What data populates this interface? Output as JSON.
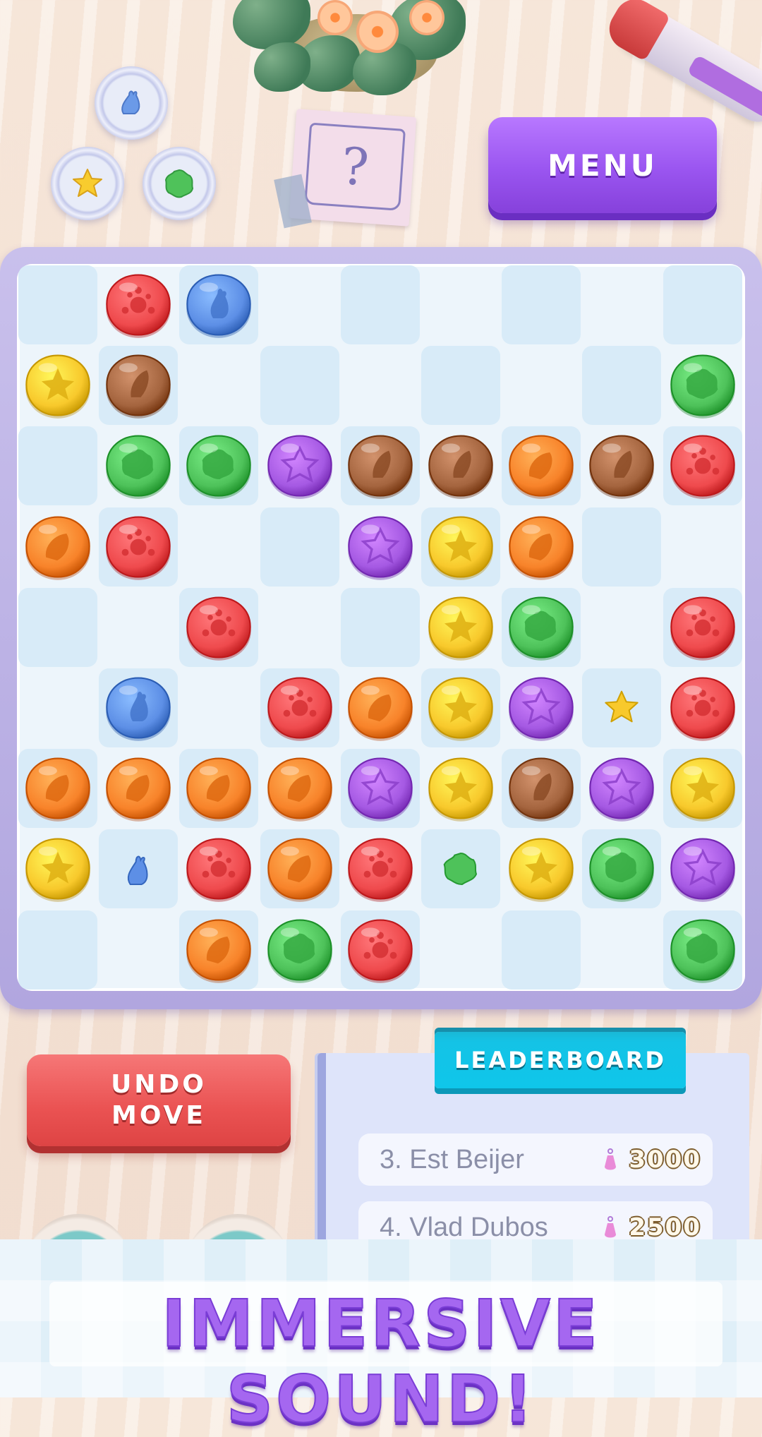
{
  "header": {
    "menu_label": "MENU",
    "goal_pieces": [
      "blue-slug-icon",
      "yellow-star-icon",
      "green-blob-icon"
    ]
  },
  "board": {
    "rows": 9,
    "cols": 9,
    "pieces": [
      [
        null,
        "red",
        "blue",
        null,
        null,
        null,
        null,
        null,
        null
      ],
      [
        "yellow",
        "brown",
        null,
        null,
        null,
        null,
        null,
        null,
        "green"
      ],
      [
        null,
        "green",
        "green",
        "purple",
        "brown",
        "brown",
        "orange",
        "brown",
        "red"
      ],
      [
        "orange",
        "red",
        null,
        null,
        "purple",
        "yellow",
        "orange",
        null,
        null
      ],
      [
        null,
        null,
        "red",
        null,
        null,
        "yellow",
        "green",
        null,
        "red"
      ],
      [
        null,
        "blue",
        null,
        "red",
        "orange",
        "yellow",
        "purple",
        "small-yellow",
        "red"
      ],
      [
        "orange",
        "orange",
        "orange",
        "orange",
        "purple",
        "yellow",
        "brown",
        "purple",
        "yellow"
      ],
      [
        "yellow",
        "small-blue",
        "red",
        "orange",
        "red",
        "small-green",
        "yellow",
        "green",
        "purple"
      ],
      [
        null,
        null,
        "orange",
        "green",
        "red",
        null,
        null,
        null,
        "green"
      ]
    ],
    "colors": {
      "red": "#ef4a4d",
      "blue": "#5d8fe6",
      "yellow": "#f8c92c",
      "brown": "#a5653f",
      "green": "#4ec25a",
      "purple": "#a559e3",
      "orange": "#f8832a"
    }
  },
  "controls": {
    "undo_line1": "UNDO",
    "undo_line2": "MOVE"
  },
  "leaderboard": {
    "title": "LEADERBOARD",
    "entries": [
      {
        "rank_name": "3. Est Beijer",
        "score": "3000"
      },
      {
        "rank_name": "4. Vlad Dubos",
        "score": "2500"
      }
    ]
  },
  "banner": {
    "text": "IMMERSIVE SOUND!"
  }
}
